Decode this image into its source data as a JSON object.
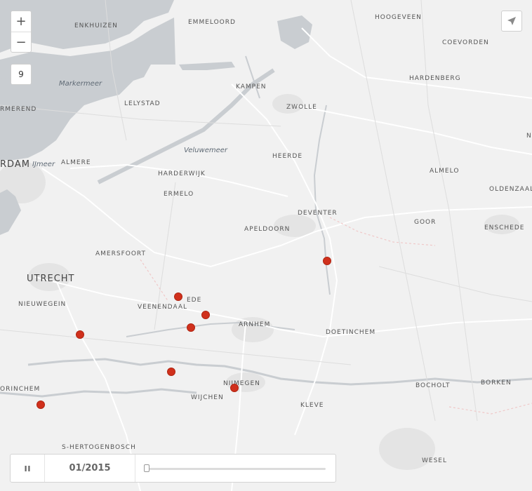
{
  "map": {
    "zoom_in_label": "+",
    "zoom_out_label": "−",
    "zoom_level": "9",
    "labels": {
      "enkhuizen": "ENKHUIZEN",
      "emmeloord": "EMMELOORD",
      "hoogeveen": "HOOGEVEEN",
      "coevorden": "COEVORDEN",
      "markermeer": "Markermeer",
      "hardenberg": "HARDENBERG",
      "kampen": "KAMPEN",
      "lelystad": "LELYSTAD",
      "zwolle": "ZWOLLE",
      "purmerend": "RMEREND",
      "veluwemeer": "Veluwemeer",
      "heerde": "HEERDE",
      "amsterdam": "RDAM",
      "ijmeer": "IJmeer",
      "almere": "ALMERE",
      "harderwijk": "HARDERWIJK",
      "almelo": "ALMELO",
      "ermelo": "ERMELO",
      "oldenzaal": "OLDENZAAL",
      "deventer": "DEVENTER",
      "goor": "GOOR",
      "apeldoorn": "APELDOORN",
      "enschede": "ENSCHEDE",
      "amersfoort": "AMERSFOORT",
      "utrecht": "UTRECHT",
      "ede": "EDE",
      "veenendaal": "VEENENDAAL",
      "nieuwegein": "NIEUWEGEIN",
      "arnhem": "ARNHEM",
      "doetinchem": "DOETINCHEM",
      "nijmegen": "NIJMEGEN",
      "bocholt": "BOCHOLT",
      "borken": "BORKEN",
      "gorinchem": "ORINCHEM",
      "wijchen": "WIJCHEN",
      "kleve": "KLEVE",
      "hertogenbosch": "S-HERTOGENBOSCH",
      "wesel": "WESEL",
      "edge_n": "N"
    },
    "marker_color": "#d0301c",
    "water_color": "#c9cdd1"
  },
  "timeline": {
    "play_state": "pause-icon",
    "date": "01/2015",
    "progress": 0
  }
}
